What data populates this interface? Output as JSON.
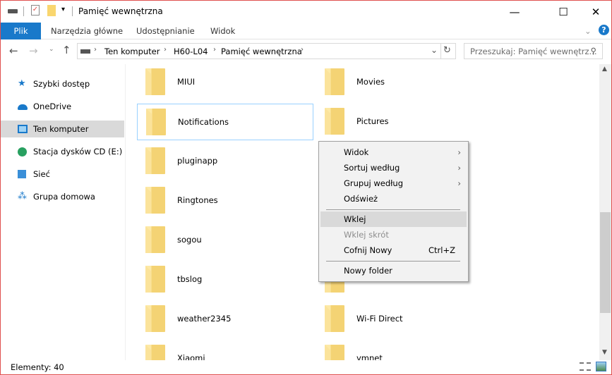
{
  "window": {
    "title": "Pamięć wewnętrzna"
  },
  "ribbon": {
    "tabs": [
      "Plik",
      "Narzędzia główne",
      "Udostępnianie",
      "Widok"
    ]
  },
  "address": {
    "crumbs": [
      "Ten komputer",
      "H60-L04",
      "Pamięć wewnętrzna"
    ]
  },
  "search": {
    "placeholder": "Przeszukaj: Pamięć wewnętrz..."
  },
  "nav": {
    "items": [
      "Szybki dostęp",
      "OneDrive",
      "Ten komputer",
      "Stacja dysków CD (E:) Hi",
      "Sieć",
      "Grupa domowa"
    ],
    "selected": "Ten komputer"
  },
  "folders": {
    "left": [
      "MIUI",
      "Notifications",
      "pluginapp",
      "Ringtones",
      "sogou",
      "tbslog",
      "weather2345",
      "Xiaomi"
    ],
    "right": [
      "Movies",
      "Pictures",
      "",
      "",
      "",
      "",
      "Wi-Fi Direct",
      "ymnet"
    ],
    "selected": "Notifications"
  },
  "context_menu": {
    "items": [
      {
        "label": "Widok",
        "submenu": true
      },
      {
        "label": "Sortuj według",
        "submenu": true
      },
      {
        "label": "Grupuj według",
        "submenu": true
      },
      {
        "label": "Odśwież"
      },
      {
        "label": "Wklej",
        "highlighted": true
      },
      {
        "label": "Wklej skrót",
        "disabled": true
      },
      {
        "label": "Cofnij Nowy",
        "shortcut": "Ctrl+Z"
      },
      {
        "label": "Nowy folder"
      }
    ]
  },
  "status": {
    "items": "Elementy: 40"
  },
  "colors": {
    "accent": "#1979ca",
    "border": "#e0504f",
    "folder": "#f4d374"
  }
}
